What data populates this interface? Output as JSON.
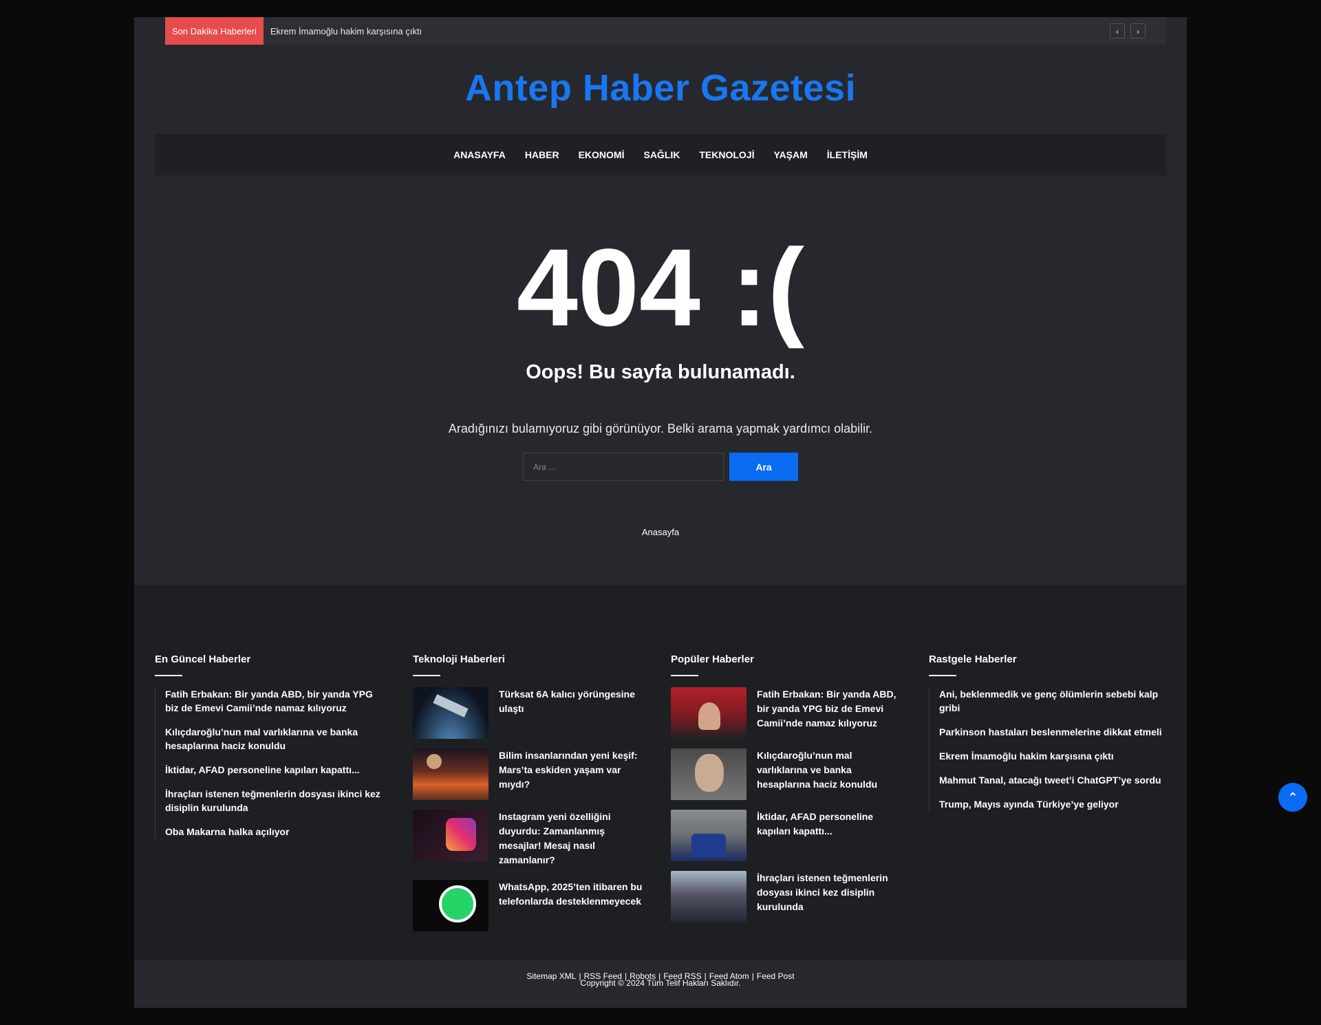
{
  "topbar": {
    "label": "Son Dakika Haberleri",
    "headline": "Ekrem İmamoğlu hakim karşısına çıktı",
    "prev_glyph": "‹",
    "next_glyph": "›"
  },
  "site": {
    "logo_text": "Antep Haber Gazetesi",
    "brand_color": "#1877f2"
  },
  "nav": [
    "ANASAYFA",
    "HABER",
    "EKONOMİ",
    "SAĞLIK",
    "TEKNOLOJİ",
    "YAŞAM",
    "İLETİŞİM"
  ],
  "error": {
    "code": "404 :(",
    "title": "Oops! Bu sayfa bulunamadı.",
    "description": "Aradığınızı bulamıyoruz gibi görünüyor. Belki arama yapmak yardımcı olabilir.",
    "search_placeholder": "Ara ...",
    "search_button": "Ara",
    "home_link": "Anasayfa"
  },
  "widgets": {
    "latest": {
      "title": "En Güncel Haberler",
      "items": [
        "Fatih Erbakan: Bir yanda ABD, bir yanda YPG biz de Emevi Camii’nde namaz kılıyoruz",
        "Kılıçdaroğlu’nun mal varlıklarına ve banka hesaplarına haciz konuldu",
        "İktidar, AFAD personeline kapıları kapattı...",
        "İhraçları istenen teğmenlerin dosyası ikinci kez disiplin kurulunda",
        "Oba Makarna halka açılıyor"
      ]
    },
    "tech": {
      "title": "Teknoloji Haberleri",
      "items": [
        {
          "text": "Türksat 6A kalıcı yörüngesine ulaştı",
          "icon": "satellite-image"
        },
        {
          "text": "Bilim insanlarından yeni keşif: Mars’ta eskiden yaşam var mıydı?",
          "icon": "mars-image"
        },
        {
          "text": "Instagram yeni özelliğini duyurdu: Zamanlanmış mesajlar! Mesaj nasıl zamanlanır?",
          "icon": "instagram-image"
        },
        {
          "text": "WhatsApp, 2025’ten itibaren bu telefonlarda desteklenmeyecek",
          "icon": "whatsapp-image"
        }
      ]
    },
    "popular": {
      "title": "Popüler Haberler",
      "items": [
        {
          "text": "Fatih Erbakan: Bir yanda ABD, bir yanda YPG biz de Emevi Camii’nde namaz kılıyoruz",
          "icon": "erbakan-image"
        },
        {
          "text": "Kılıçdaroğlu’nun mal varlıklarına ve banka hesaplarına haciz konuldu",
          "icon": "kilicdaroglu-image"
        },
        {
          "text": "İktidar, AFAD personeline kapıları kapattı...",
          "icon": "afad-image"
        },
        {
          "text": "İhraçları istenen teğmenlerin dosyası ikinci kez disiplin kurulunda",
          "icon": "ceremony-image"
        }
      ]
    },
    "random": {
      "title": "Rastgele Haberler",
      "items": [
        "Ani, beklenmedik ve genç ölümlerin sebebi kalp gribi",
        "Parkinson hastaları beslenmelerine dikkat etmeli",
        "Ekrem İmamoğlu hakim karşısına çıktı",
        "Mahmut Tanal, atacağı tweet’i ChatGPT’ye sordu",
        "Trump, Mayıs ayında Türkiye’ye geliyor"
      ]
    }
  },
  "footer": {
    "links": [
      "Sitemap XML",
      "RSS Feed",
      "Robots",
      "Feed RSS",
      "Feed Atom",
      "Feed Post"
    ],
    "separator": "|",
    "copyright": "Copyright © 2024 Tüm Telif Hakları Saklıdır."
  },
  "back_to_top_glyph": "⌃"
}
